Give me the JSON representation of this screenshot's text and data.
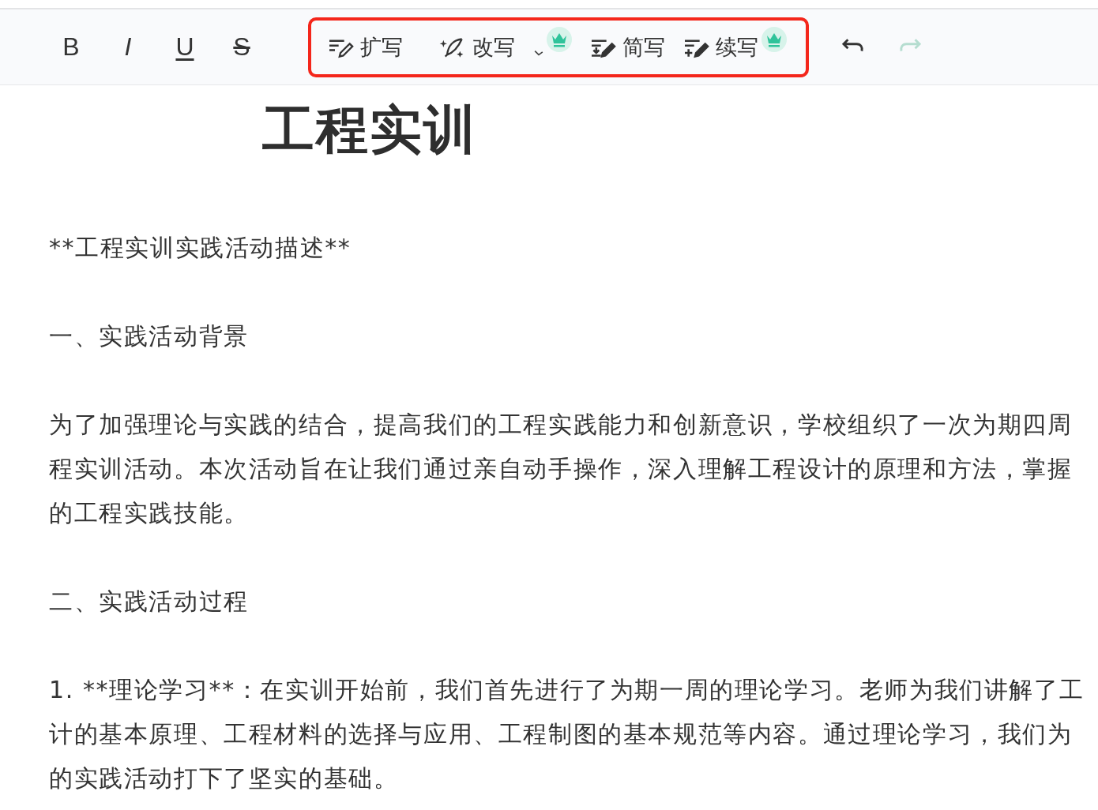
{
  "toolbar": {
    "format_buttons": [
      {
        "kind": "bold",
        "label": "B"
      },
      {
        "kind": "italic",
        "label": "I"
      },
      {
        "kind": "underline",
        "label": "U"
      },
      {
        "kind": "strike",
        "label": "S"
      }
    ],
    "ai_tools": [
      {
        "kind": "expand",
        "label": "扩写",
        "premium": false,
        "dropdown": false
      },
      {
        "kind": "rewrite",
        "label": "改写",
        "premium": true,
        "dropdown": true
      },
      {
        "kind": "shorten",
        "label": "简写",
        "premium": false,
        "dropdown": false
      },
      {
        "kind": "continue",
        "label": "续写",
        "premium": true,
        "dropdown": false
      }
    ],
    "highlighted": true,
    "history": [
      {
        "kind": "undo",
        "disabled": false
      },
      {
        "kind": "redo",
        "disabled": true
      }
    ]
  },
  "document": {
    "title": "工程实训",
    "paragraphs": [
      [
        "**工程实训实践活动描述**"
      ],
      [
        "一、实践活动背景"
      ],
      [
        "为了加强理论与实践的结合，提高我们的工程实践能力和创新意识，学校组织了一次为期四周",
        "程实训活动。本次活动旨在让我们通过亲自动手操作，深入理解工程设计的原理和方法，掌握",
        "的工程实践技能。"
      ],
      [
        "二、实践活动过程"
      ],
      [
        "1. **理论学习**：在实训开始前，我们首先进行了为期一周的理论学习。老师为我们讲解了工",
        "计的基本原理、工程材料的选择与应用、工程制图的基本规范等内容。通过理论学习，我们为",
        "的实践活动打下了坚实的基础。"
      ]
    ]
  }
}
